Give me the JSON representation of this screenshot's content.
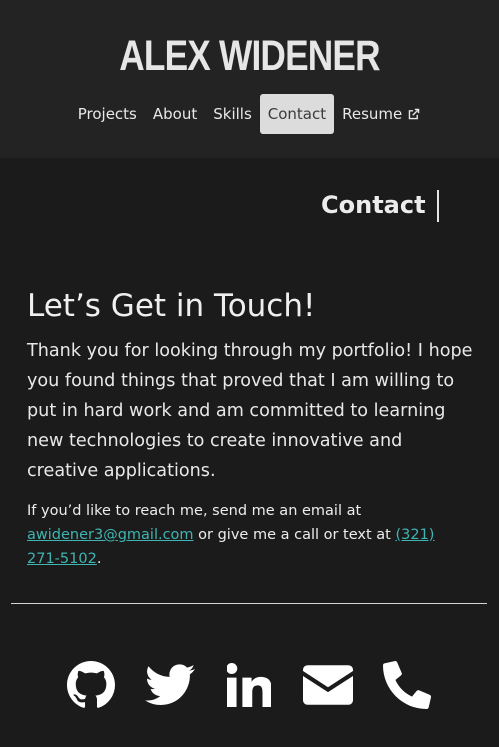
{
  "header": {
    "brand": "ALEX WIDENER",
    "nav": [
      {
        "label": "Projects"
      },
      {
        "label": "About"
      },
      {
        "label": "Skills"
      },
      {
        "label": "Contact",
        "active": true
      },
      {
        "label": "Resume",
        "icon": "external-link-icon"
      }
    ]
  },
  "main": {
    "section_title": "Contact",
    "heading": "Let’s Get in Touch!",
    "lead": "Thank you for looking through my portfolio! I hope you found things that proved that I am willing to put in hard work and am committed to learning new technologies to create innovative and creative applications.",
    "contact": {
      "prefix": "If you’d like to reach me, send me an email at",
      "email": "awidener3@gmail.com",
      "middle": "or give me a call or text at",
      "phone": "(321) 271-5102",
      "suffix": "."
    }
  },
  "socials": [
    {
      "icon": "github-icon"
    },
    {
      "icon": "twitter-icon"
    },
    {
      "icon": "linkedin-icon"
    },
    {
      "icon": "envelope-icon"
    },
    {
      "icon": "phone-icon"
    }
  ],
  "colors": {
    "background": "#1b1b1b",
    "header_background": "#232323",
    "link": "#3fb4b2",
    "active_nav": "#dcdcdc"
  }
}
